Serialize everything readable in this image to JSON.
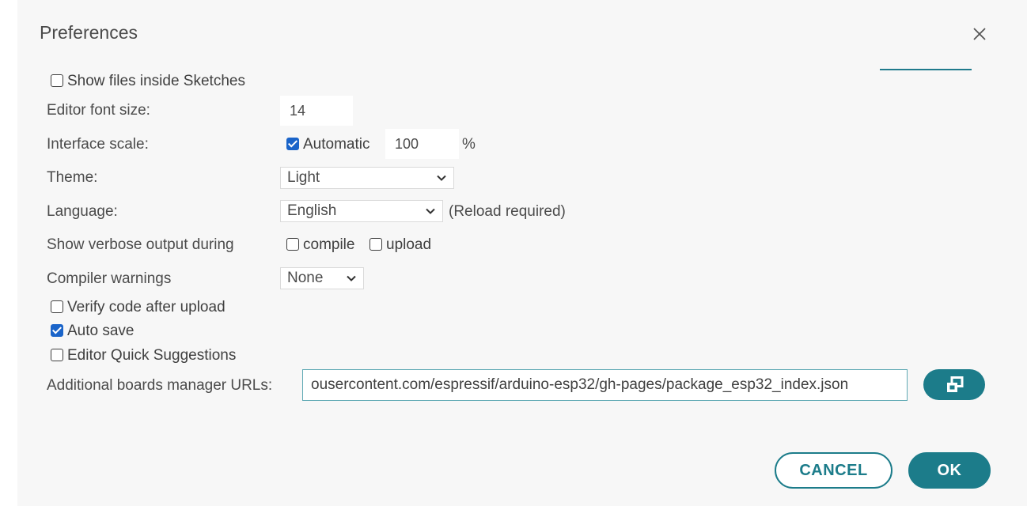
{
  "dialog": {
    "title": "Preferences"
  },
  "prefs": {
    "show_files_label": "Show files inside Sketches",
    "show_files_checked": false,
    "font_size_label": "Editor font size:",
    "font_size_value": "14",
    "scale_label": "Interface scale:",
    "scale_auto_label": "Automatic",
    "scale_auto_checked": true,
    "scale_value": "100",
    "scale_unit": "%",
    "theme_label": "Theme:",
    "theme_value": "Light",
    "language_label": "Language:",
    "language_value": "English",
    "language_note": "(Reload required)",
    "verbose_label": "Show verbose output during",
    "verbose_compile_label": "compile",
    "verbose_compile_checked": false,
    "verbose_upload_label": "upload",
    "verbose_upload_checked": false,
    "warnings_label": "Compiler warnings",
    "warnings_value": "None",
    "verify_label": "Verify code after upload",
    "verify_checked": false,
    "autosave_label": "Auto save",
    "autosave_checked": true,
    "suggestions_label": "Editor Quick Suggestions",
    "suggestions_checked": false,
    "boards_url_label": "Additional boards manager URLs:",
    "boards_url_value": "ousercontent.com/espressif/arduino-esp32/gh-pages/package_esp32_index.json"
  },
  "footer": {
    "cancel_label": "CANCEL",
    "ok_label": "OK"
  },
  "icons": {
    "close": "close-icon",
    "open_window": "open-window-icon",
    "chevron": "chevron-down-icon"
  },
  "colors": {
    "accent": "#1c7c8a",
    "checkbox_checked": "#1a64c9"
  }
}
